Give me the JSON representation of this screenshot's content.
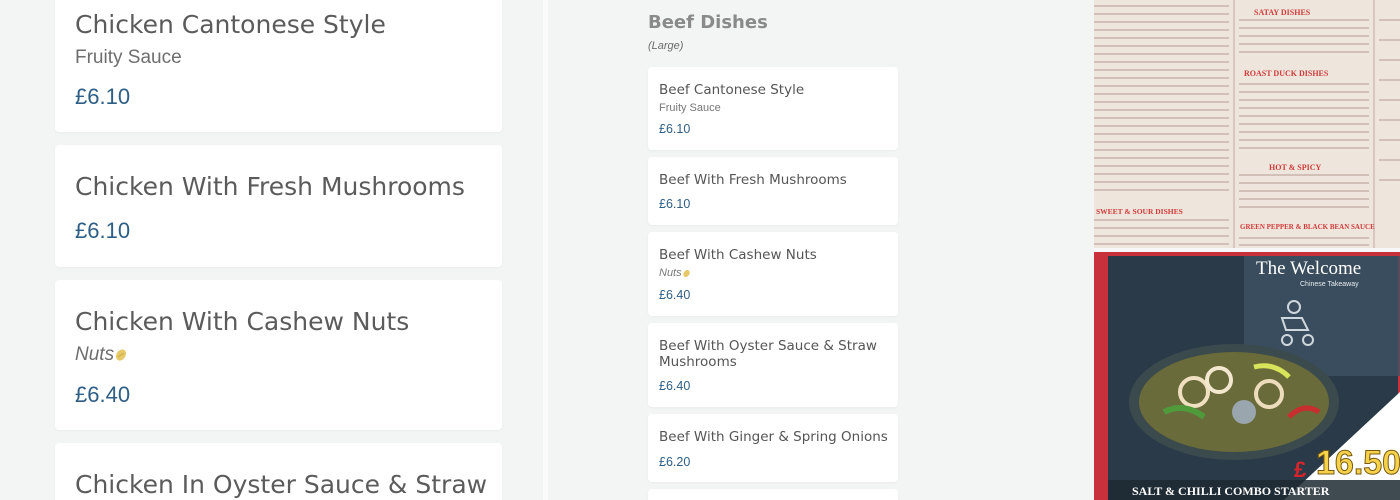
{
  "left_items": [
    {
      "name": "Chicken Cantonese Style",
      "desc": "Fruity Sauce",
      "price": "£6.10"
    },
    {
      "name": "Chicken With Fresh Mushrooms",
      "price": "£6.10"
    },
    {
      "name": "Chicken With Cashew Nuts",
      "desc": "Nuts",
      "price": "£6.40"
    },
    {
      "name": "Chicken In Oyster Sauce & Straw"
    }
  ],
  "section": {
    "title": "Beef Dishes",
    "subtitle": "(Large)"
  },
  "beef_items": [
    {
      "name": "Beef Cantonese Style",
      "desc": "Fruity Sauce",
      "price": "£6.10"
    },
    {
      "name": "Beef With Fresh Mushrooms",
      "price": "£6.10"
    },
    {
      "name": "Beef With Cashew Nuts",
      "desc": "Nuts",
      "price": "£6.40"
    },
    {
      "name": "Beef With Oyster Sauce & Straw Mushrooms",
      "price": "£6.40"
    },
    {
      "name": "Beef With Ginger & Spring Onions",
      "price": "£6.20"
    }
  ],
  "promo": {
    "brand": "The Welcome",
    "tagline": "Chinese Takeaway",
    "currency": "£",
    "price": "16.50",
    "caption": "SALT & CHILLI COMBO STARTER"
  },
  "menu_photo": {
    "headings": [
      "SATAY DISHES",
      "ROAST DUCK DISHES",
      "HOT & SPICY",
      "SWEET & SOUR DISHES",
      "GREEN PEPPER & BLACK BEAN SAUCE"
    ]
  },
  "colors": {
    "price": "#2e5e86",
    "accent": "#c8303c",
    "gold": "#f6d24a"
  }
}
